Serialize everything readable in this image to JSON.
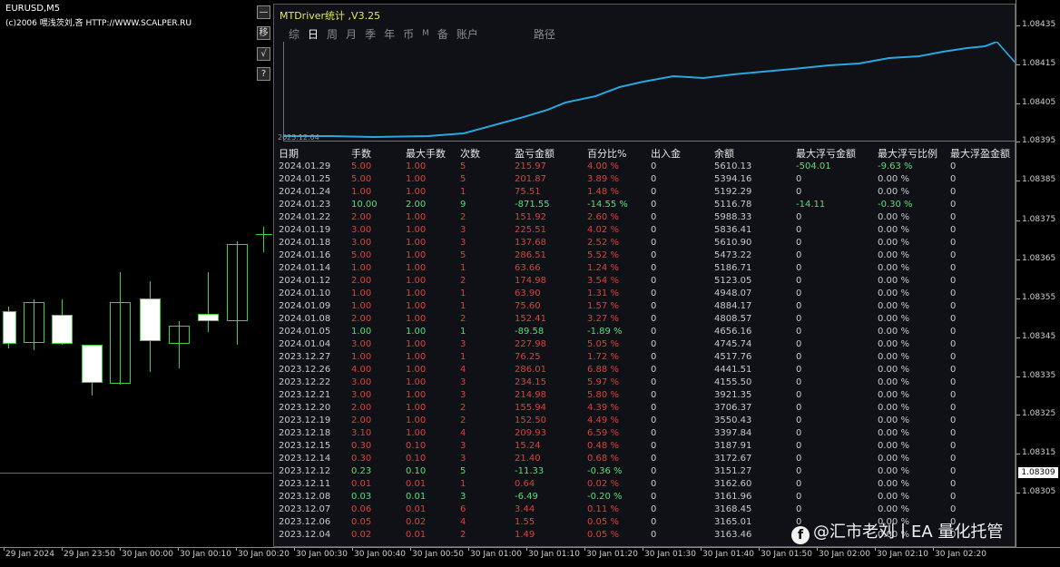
{
  "symbol": {
    "name": "EURUSD,M5",
    "copyright": "(c)2006 喂浅茨刘,吝 HTTP://WWW.SCALPER.RU"
  },
  "side_buttons": [
    "—",
    "移",
    "√",
    "?"
  ],
  "panel": {
    "title": "MTDriver统计 ,V3.25",
    "tabs": [
      "综",
      "日",
      "周",
      "月",
      "季",
      "年",
      "币",
      "M",
      "备",
      "账户",
      "路径"
    ],
    "equity_date": "2023.12.04",
    "headers": [
      "日期",
      "手数",
      "最大手数",
      "次数",
      "盈亏金额",
      "百分比%",
      "出入金",
      "余额",
      "最大浮亏金额",
      "最大浮亏比例",
      "最大浮盈金额"
    ],
    "rows": [
      [
        "2024.01.29",
        "5.00",
        "1.00",
        "5",
        "215.97",
        "4.00 %",
        "0",
        "5610.13",
        "-504.01",
        "-9.63 %",
        "0"
      ],
      [
        "2024.01.25",
        "5.00",
        "1.00",
        "5",
        "201.87",
        "3.89 %",
        "0",
        "5394.16",
        "0",
        "0.00 %",
        "0"
      ],
      [
        "2024.01.24",
        "1.00",
        "1.00",
        "1",
        "75.51",
        "1.48 %",
        "0",
        "5192.29",
        "0",
        "0.00 %",
        "0"
      ],
      [
        "2024.01.23",
        "10.00",
        "2.00",
        "9",
        "-871.55",
        "-14.55 %",
        "0",
        "5116.78",
        "-14.11",
        "-0.30 %",
        "0"
      ],
      [
        "2024.01.22",
        "2.00",
        "1.00",
        "2",
        "151.92",
        "2.60 %",
        "0",
        "5988.33",
        "0",
        "0.00 %",
        "0"
      ],
      [
        "2024.01.19",
        "3.00",
        "1.00",
        "3",
        "225.51",
        "4.02 %",
        "0",
        "5836.41",
        "0",
        "0.00 %",
        "0"
      ],
      [
        "2024.01.18",
        "3.00",
        "1.00",
        "3",
        "137.68",
        "2.52 %",
        "0",
        "5610.90",
        "0",
        "0.00 %",
        "0"
      ],
      [
        "2024.01.16",
        "5.00",
        "1.00",
        "5",
        "286.51",
        "5.52 %",
        "0",
        "5473.22",
        "0",
        "0.00 %",
        "0"
      ],
      [
        "2024.01.14",
        "1.00",
        "1.00",
        "1",
        "63.66",
        "1.24 %",
        "0",
        "5186.71",
        "0",
        "0.00 %",
        "0"
      ],
      [
        "2024.01.12",
        "2.00",
        "1.00",
        "2",
        "174.98",
        "3.54 %",
        "0",
        "5123.05",
        "0",
        "0.00 %",
        "0"
      ],
      [
        "2024.01.10",
        "1.00",
        "1.00",
        "1",
        "63.90",
        "1.31 %",
        "0",
        "4948.07",
        "0",
        "0.00 %",
        "0"
      ],
      [
        "2024.01.09",
        "1.00",
        "1.00",
        "1",
        "75.60",
        "1.57 %",
        "0",
        "4884.17",
        "0",
        "0.00 %",
        "0"
      ],
      [
        "2024.01.08",
        "2.00",
        "1.00",
        "2",
        "152.41",
        "3.27 %",
        "0",
        "4808.57",
        "0",
        "0.00 %",
        "0"
      ],
      [
        "2024.01.05",
        "1.00",
        "1.00",
        "1",
        "-89.58",
        "-1.89 %",
        "0",
        "4656.16",
        "0",
        "0.00 %",
        "0"
      ],
      [
        "2024.01.04",
        "3.00",
        "1.00",
        "3",
        "227.98",
        "5.05 %",
        "0",
        "4745.74",
        "0",
        "0.00 %",
        "0"
      ],
      [
        "2023.12.27",
        "1.00",
        "1.00",
        "1",
        "76.25",
        "1.72 %",
        "0",
        "4517.76",
        "0",
        "0.00 %",
        "0"
      ],
      [
        "2023.12.26",
        "4.00",
        "1.00",
        "4",
        "286.01",
        "6.88 %",
        "0",
        "4441.51",
        "0",
        "0.00 %",
        "0"
      ],
      [
        "2023.12.22",
        "3.00",
        "1.00",
        "3",
        "234.15",
        "5.97 %",
        "0",
        "4155.50",
        "0",
        "0.00 %",
        "0"
      ],
      [
        "2023.12.21",
        "3.00",
        "1.00",
        "3",
        "214.98",
        "5.80 %",
        "0",
        "3921.35",
        "0",
        "0.00 %",
        "0"
      ],
      [
        "2023.12.20",
        "2.00",
        "1.00",
        "2",
        "155.94",
        "4.39 %",
        "0",
        "3706.37",
        "0",
        "0.00 %",
        "0"
      ],
      [
        "2023.12.19",
        "2.00",
        "1.00",
        "2",
        "152.50",
        "4.49 %",
        "0",
        "3550.43",
        "0",
        "0.00 %",
        "0"
      ],
      [
        "2023.12.18",
        "3.10",
        "1.00",
        "4",
        "209.93",
        "6.59 %",
        "0",
        "3397.84",
        "0",
        "0.00 %",
        "0"
      ],
      [
        "2023.12.15",
        "0.30",
        "0.10",
        "3",
        "15.24",
        "0.48 %",
        "0",
        "3187.91",
        "0",
        "0.00 %",
        "0"
      ],
      [
        "2023.12.14",
        "0.30",
        "0.10",
        "3",
        "21.40",
        "0.68 %",
        "0",
        "3172.67",
        "0",
        "0.00 %",
        "0"
      ],
      [
        "2023.12.12",
        "0.23",
        "0.10",
        "5",
        "-11.33",
        "-0.36 %",
        "0",
        "3151.27",
        "0",
        "0.00 %",
        "0"
      ],
      [
        "2023.12.11",
        "0.01",
        "0.01",
        "1",
        "0.64",
        "0.02 %",
        "0",
        "3162.60",
        "0",
        "0.00 %",
        "0"
      ],
      [
        "2023.12.08",
        "0.03",
        "0.01",
        "3",
        "-6.49",
        "-0.20 %",
        "0",
        "3161.96",
        "0",
        "0.00 %",
        "0"
      ],
      [
        "2023.12.07",
        "0.06",
        "0.01",
        "6",
        "3.44",
        "0.11 %",
        "0",
        "3168.45",
        "0",
        "0.00 %",
        "0"
      ],
      [
        "2023.12.06",
        "0.05",
        "0.02",
        "4",
        "1.55",
        "0.05 %",
        "0",
        "3165.01",
        "0",
        "0.00 %",
        "0"
      ],
      [
        "2023.12.04",
        "0.02",
        "0.01",
        "2",
        "1.49",
        "0.05 %",
        "0",
        "3163.46",
        "0",
        "0.00 %",
        "0"
      ]
    ],
    "row_colors": [
      "red",
      "red",
      "red",
      "green",
      "red",
      "red",
      "red",
      "red",
      "red",
      "red",
      "red",
      "red",
      "red",
      "green",
      "red",
      "red",
      "red",
      "red",
      "red",
      "red",
      "red",
      "red",
      "red",
      "red",
      "green",
      "red",
      "green",
      "red",
      "red",
      "red"
    ]
  },
  "price_scale": [
    "1.08435",
    "1.08415",
    "1.08405",
    "1.08395",
    "1.08385",
    "1.08375",
    "1.08365",
    "1.08355",
    "1.08345",
    "1.08335",
    "1.08325",
    "1.08315",
    "1.08305"
  ],
  "current_price": "1.08309",
  "time_axis": [
    "29 Jan 2024",
    "29 Jan 23:50",
    "30 Jan 00:00",
    "30 Jan 00:10",
    "30 Jan 00:20",
    "30 Jan 00:30",
    "30 Jan 00:40",
    "30 Jan 00:50",
    "30 Jan 01:00",
    "30 Jan 01:10",
    "30 Jan 01:20",
    "30 Jan 01:30",
    "30 Jan 01:40",
    "30 Jan 01:50",
    "30 Jan 02:00",
    "30 Jan 02:10",
    "30 Jan 02:20"
  ],
  "watermark": "@汇市老刘丨EA 量化托管",
  "colors": {
    "accent_line": "#29a8e0",
    "loss_green": "#4fe07a",
    "profit_red": "#e43d3d",
    "candle": "#3fd13f",
    "title": "#e6e65a"
  }
}
